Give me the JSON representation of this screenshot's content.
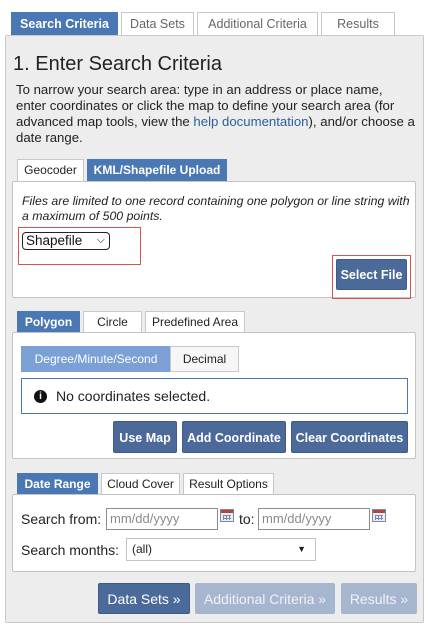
{
  "top_tabs": [
    {
      "label": "Search Criteria",
      "active": true
    },
    {
      "label": "Data Sets",
      "active": false
    },
    {
      "label": "Additional Criteria",
      "active": false
    },
    {
      "label": "Results",
      "active": false
    }
  ],
  "heading": "1. Enter Search Criteria",
  "intro": {
    "before_link": "To narrow your search area: type in an address or place name, enter coordinates or click the map to define your search area (for advanced map tools, view the ",
    "link": "help documentation",
    "after_link": "), and/or choose a date range."
  },
  "area_tabs": [
    {
      "label": "Geocoder",
      "active": false
    },
    {
      "label": "KML/Shapefile Upload",
      "active": true
    }
  ],
  "kml": {
    "note": "Files are limited to one record containing one polygon or line string with a maximum of 500 points.",
    "file_type": "Shapefile",
    "select_file_label": "Select File"
  },
  "shape_tabs": [
    {
      "label": "Polygon",
      "active": true
    },
    {
      "label": "Circle",
      "active": false
    },
    {
      "label": "Predefined Area",
      "active": false
    }
  ],
  "coord_format": [
    {
      "label": "Degree/Minute/Second",
      "active": true
    },
    {
      "label": "Decimal",
      "active": false
    }
  ],
  "coords_message": "No coordinates selected.",
  "coord_buttons": {
    "use_map": "Use Map",
    "add_coordinate": "Add Coordinate",
    "clear_coordinates": "Clear Coordinates"
  },
  "date_tabs": [
    {
      "label": "Date Range",
      "active": true
    },
    {
      "label": "Cloud Cover",
      "active": false
    },
    {
      "label": "Result Options",
      "active": false
    }
  ],
  "date_range": {
    "from_label": "Search from:",
    "from_placeholder": "mm/dd/yyyy",
    "to_label": "to:",
    "to_placeholder": "mm/dd/yyyy",
    "months_label": "Search months:",
    "months_value": "(all)"
  },
  "nav_buttons": {
    "data_sets": "Data Sets »",
    "additional_criteria": "Additional Criteria »",
    "results": "Results »"
  },
  "icons": {
    "info": "info-circle-icon",
    "calendar": "calendar-icon",
    "chevron": "chevron-down-icon"
  },
  "colors": {
    "active_tab": "#4a78b5",
    "button": "#4c6a99",
    "button_disabled": "#a7b6cf",
    "highlight_outline": "#d9534f",
    "link": "#2a5f9e"
  }
}
